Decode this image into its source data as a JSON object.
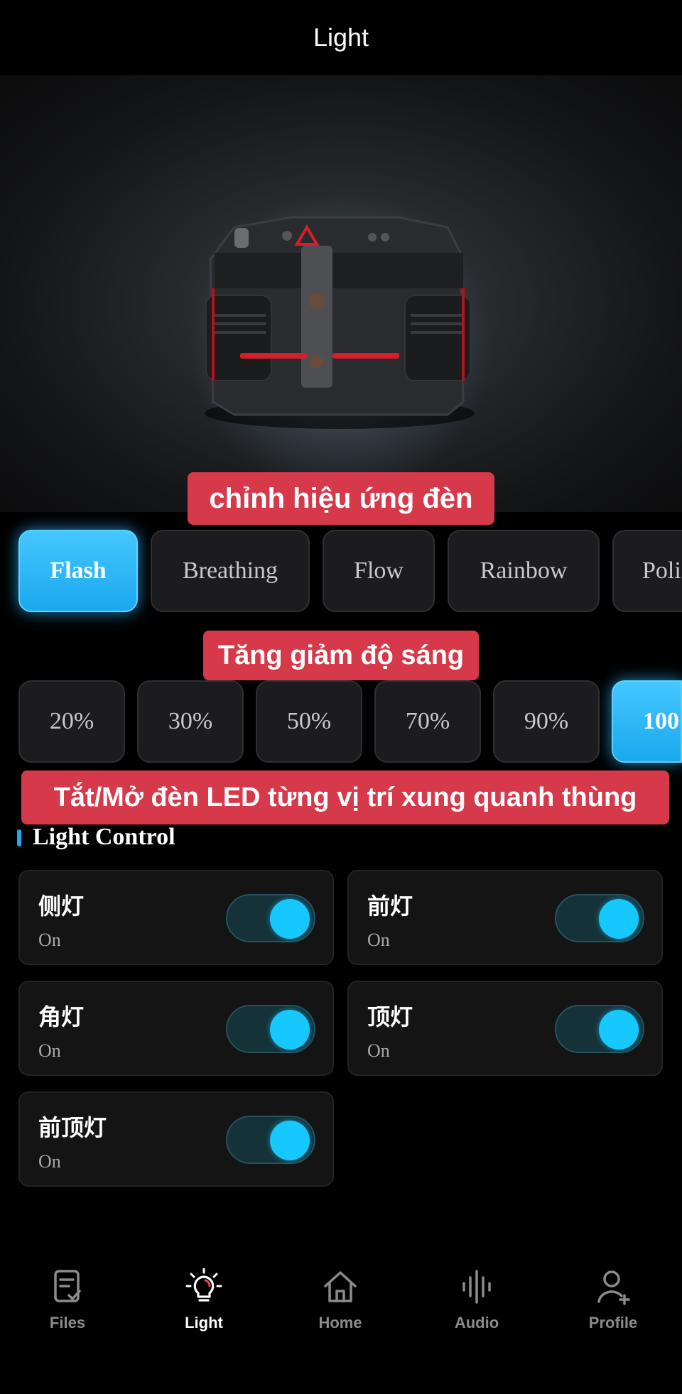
{
  "header": {
    "title": "Light"
  },
  "annotations": {
    "effects": "chỉnh hiệu ứng đèn",
    "brightness": "Tăng giảm độ sáng",
    "led": "Tắt/Mở đèn LED từng vị trí xung quanh thùng"
  },
  "effects": [
    {
      "label": "Flash",
      "selected": true
    },
    {
      "label": "Breathing",
      "selected": false
    },
    {
      "label": "Flow",
      "selected": false
    },
    {
      "label": "Rainbow",
      "selected": false
    },
    {
      "label": "Poli",
      "selected": false
    }
  ],
  "brightness": [
    {
      "label": "20%",
      "selected": false
    },
    {
      "label": "30%",
      "selected": false
    },
    {
      "label": "50%",
      "selected": false
    },
    {
      "label": "70%",
      "selected": false
    },
    {
      "label": "90%",
      "selected": false
    },
    {
      "label": "100",
      "selected": true
    }
  ],
  "light_control": {
    "title": "Light Control",
    "items": [
      {
        "name": "侧灯",
        "state": "On",
        "on": true
      },
      {
        "name": "前灯",
        "state": "On",
        "on": true
      },
      {
        "name": "角灯",
        "state": "On",
        "on": true
      },
      {
        "name": "顶灯",
        "state": "On",
        "on": true
      },
      {
        "name": "前顶灯",
        "state": "On",
        "on": true
      }
    ]
  },
  "tabs": [
    {
      "label": "Files",
      "icon": "files-icon",
      "active": false
    },
    {
      "label": "Light",
      "icon": "bulb-icon",
      "active": true
    },
    {
      "label": "Home",
      "icon": "home-icon",
      "active": false
    },
    {
      "label": "Audio",
      "icon": "audio-icon",
      "active": false
    },
    {
      "label": "Profile",
      "icon": "profile-icon",
      "active": false
    }
  ],
  "colors": {
    "accent": "#1eaaf0",
    "callout": "#d6394a",
    "toggle_knob": "#17c8ff"
  }
}
